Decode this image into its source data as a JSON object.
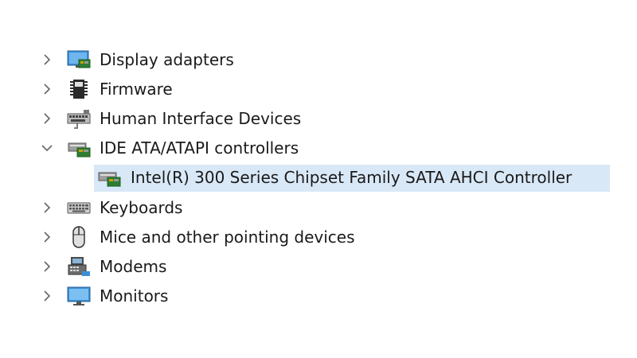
{
  "device_tree": {
    "items": [
      {
        "label": "Display adapters",
        "icon": "display-adapter-icon",
        "expanded": false
      },
      {
        "label": "Firmware",
        "icon": "firmware-chip-icon",
        "expanded": false
      },
      {
        "label": "Human Interface Devices",
        "icon": "hid-keyboard-icon",
        "expanded": false
      },
      {
        "label": "IDE ATA/ATAPI controllers",
        "icon": "ide-controller-icon",
        "expanded": true,
        "children": [
          {
            "label": "Intel(R) 300 Series Chipset Family SATA AHCI Controller",
            "icon": "sata-controller-icon",
            "selected": true
          }
        ]
      },
      {
        "label": "Keyboards",
        "icon": "keyboard-icon",
        "expanded": false
      },
      {
        "label": "Mice and other pointing devices",
        "icon": "mouse-icon",
        "expanded": false
      },
      {
        "label": "Modems",
        "icon": "modem-icon",
        "expanded": false
      },
      {
        "label": "Monitors",
        "icon": "monitor-icon",
        "expanded": false
      }
    ]
  },
  "colors": {
    "selection_background": "#d9e8f7",
    "chevron": "#666666",
    "text": "#1a1a1a"
  }
}
